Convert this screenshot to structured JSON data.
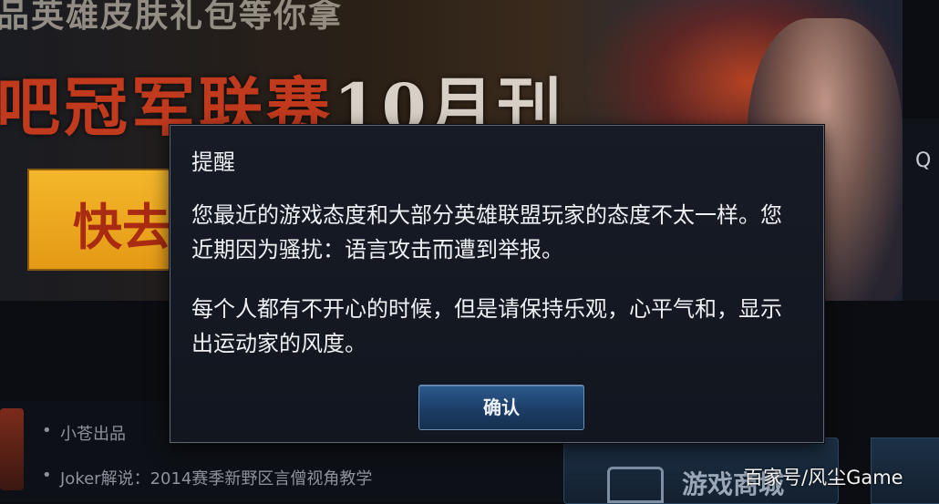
{
  "background": {
    "banner_line1": "品英雄皮肤礼包等你拿",
    "banner_line2_main": "吧冠军联赛",
    "banner_line2_light": "10月刊",
    "banner_cta": "快去",
    "side_label": "Q",
    "news_items": [
      "小苍出品",
      "Joker解说：2014赛季新野区言僧视角教学"
    ],
    "shop_label": "游戏商城"
  },
  "dialog": {
    "title": "提醒",
    "paragraph1": "您最近的游戏态度和大部分英雄联盟玩家的态度不太一样。您近期因为骚扰：语言攻击而遭到举报。",
    "paragraph2": "每个人都有不开心的时候，但是请保持乐观，心平气和，显示出运动家的风度。",
    "confirm_label": "确认"
  },
  "watermark": "百家号/风尘Game",
  "colors": {
    "dialog_bg": "#141922",
    "dialog_border": "#5d6675",
    "button_blue": "#1c3d66",
    "banner_red": "#c13a1e",
    "cta_yellow": "#f3b72b"
  }
}
